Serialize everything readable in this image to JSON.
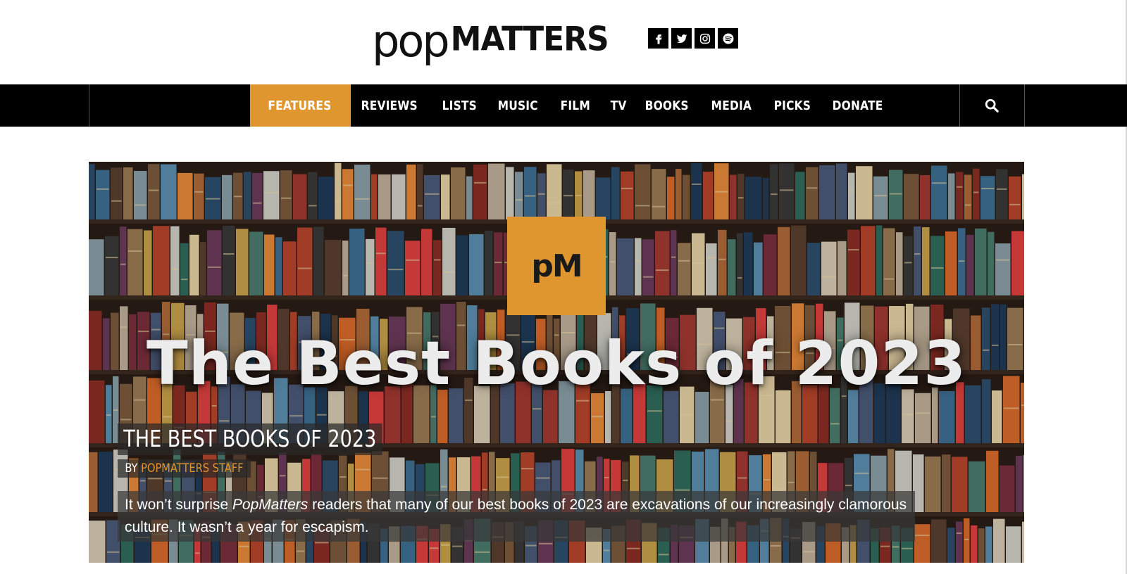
{
  "header": {
    "logo_pop": "pop",
    "logo_matters": "MATTERS",
    "social": [
      "facebook-icon",
      "twitter-icon",
      "instagram-icon",
      "spotify-icon"
    ]
  },
  "nav": {
    "items": [
      {
        "label": "FEATURES",
        "active": true
      },
      {
        "label": "REVIEWS"
      },
      {
        "label": "LISTS"
      },
      {
        "label": "MUSIC"
      },
      {
        "label": "FILM"
      },
      {
        "label": "TV"
      },
      {
        "label": "BOOKS"
      },
      {
        "label": "MEDIA"
      },
      {
        "label": "PICKS"
      },
      {
        "label": "DONATE"
      }
    ],
    "search_icon": "search-icon"
  },
  "hero": {
    "badge_text": "pM",
    "image_title": "The Best Books of 2023",
    "caption_title": "THE BEST BOOKS OF 2023",
    "byline_prefix": "BY",
    "byline_author": "POPMATTERS STAFF",
    "desc_before": "It won’t surprise ",
    "desc_em": "PopMatters",
    "desc_after": " readers that many of our best books of 2023 are excavations of our increasingly clamorous culture. It wasn’t a year for escapism."
  },
  "colors": {
    "accent": "#e0962f",
    "nav_bg": "#000000",
    "page_bg": "#ffffff"
  }
}
